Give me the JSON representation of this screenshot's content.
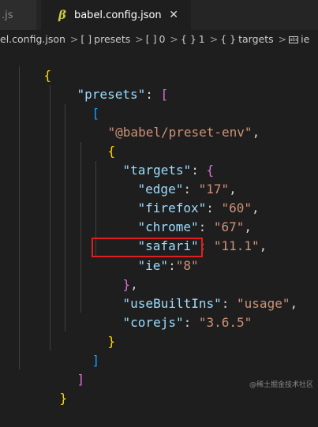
{
  "tabs": {
    "prev_label": ".js",
    "active_icon": "β",
    "active_label": "babel.config.json",
    "close": "✕"
  },
  "breadcrumb": {
    "file": "el.config.json",
    "sep": ">",
    "presets_sym": "[ ]",
    "presets": "presets",
    "idx_sym": "[ ]",
    "idx": "0",
    "obj_sym": "{ }",
    "obj": "1",
    "targets_sym": "{ }",
    "targets": "targets",
    "ie_icon": "abc",
    "ie": "ie"
  },
  "code": {
    "l1": {
      "open": "{"
    },
    "l2": {
      "key": "\"presets\"",
      "colon": ": ",
      "open": "["
    },
    "l3": {
      "open": "["
    },
    "l4": {
      "str": "\"@babel/preset-env\"",
      "comma": ","
    },
    "l5": {
      "open": "{"
    },
    "l6": {
      "key": "\"targets\"",
      "colon": ": ",
      "open": "{"
    },
    "l7": {
      "key": "\"edge\"",
      "colon": ": ",
      "val": "\"17\"",
      "comma": ","
    },
    "l8": {
      "key": "\"firefox\"",
      "colon": ": ",
      "val": "\"60\"",
      "comma": ","
    },
    "l9": {
      "key": "\"chrome\"",
      "colon": ": ",
      "val": "\"67\"",
      "comma": ","
    },
    "l10": {
      "key": "\"safari\"",
      "colon": ": ",
      "val": "\"11.1\"",
      "comma": ","
    },
    "l11": {
      "key": "\"ie\"",
      "colon": ":",
      "val": "\"8\""
    },
    "l12": {
      "close": "}",
      "comma": ","
    },
    "l13": {
      "key": "\"useBuiltIns\"",
      "colon": ": ",
      "val": "\"usage\"",
      "comma": ","
    },
    "l14": {
      "key": "\"corejs\"",
      "colon": ": ",
      "val": "\"3.6.5\""
    },
    "l15": {
      "close": "}"
    },
    "l16": {
      "close": "]"
    },
    "l17": {
      "close": "]"
    },
    "l18": {
      "close": "}"
    }
  },
  "watermark": "@稀土掘金技术社区",
  "colors": {
    "background": "#1e1e1e",
    "key": "#9cdcfe",
    "string": "#ce9178",
    "bracket_gold": "#ffd700",
    "bracket_purple": "#da70d6",
    "bracket_blue": "#179fff",
    "highlight_box": "#e02020"
  }
}
